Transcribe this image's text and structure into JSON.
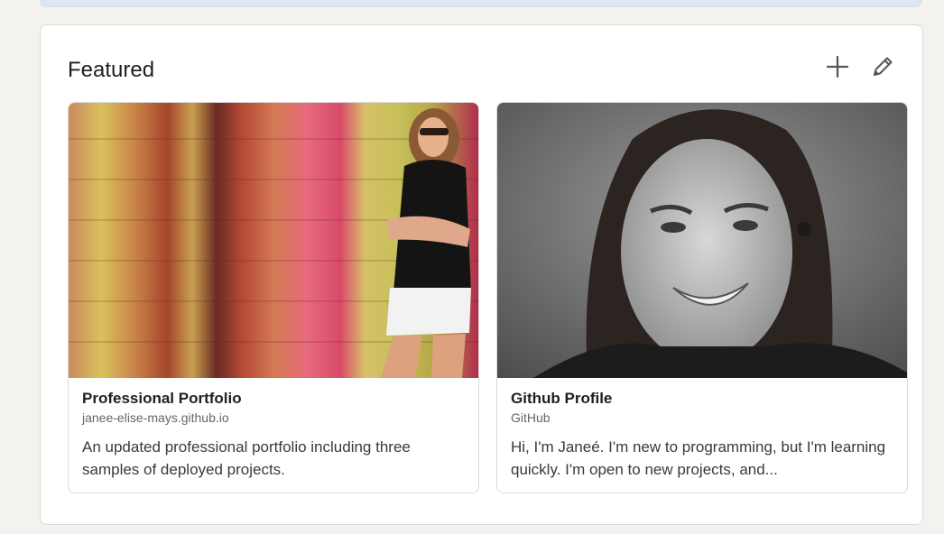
{
  "featured": {
    "title": "Featured",
    "icons": {
      "add": "plus-icon",
      "edit": "pencil-icon"
    },
    "items": [
      {
        "title": "Professional Portfolio",
        "subtitle": "janee-elise-mays.github.io",
        "description": "An updated professional portfolio including three samples of deployed projects."
      },
      {
        "title": "Github Profile",
        "subtitle": "GitHub",
        "description": "Hi, I'm Janeé. I'm new to programming, but I'm learning quickly. I'm open to new projects, and..."
      }
    ]
  },
  "colors": {
    "page_bg": "#f4f2ee",
    "card_bg": "#ffffff",
    "text_primary": "#1f1f1f",
    "text_secondary": "#666666"
  }
}
